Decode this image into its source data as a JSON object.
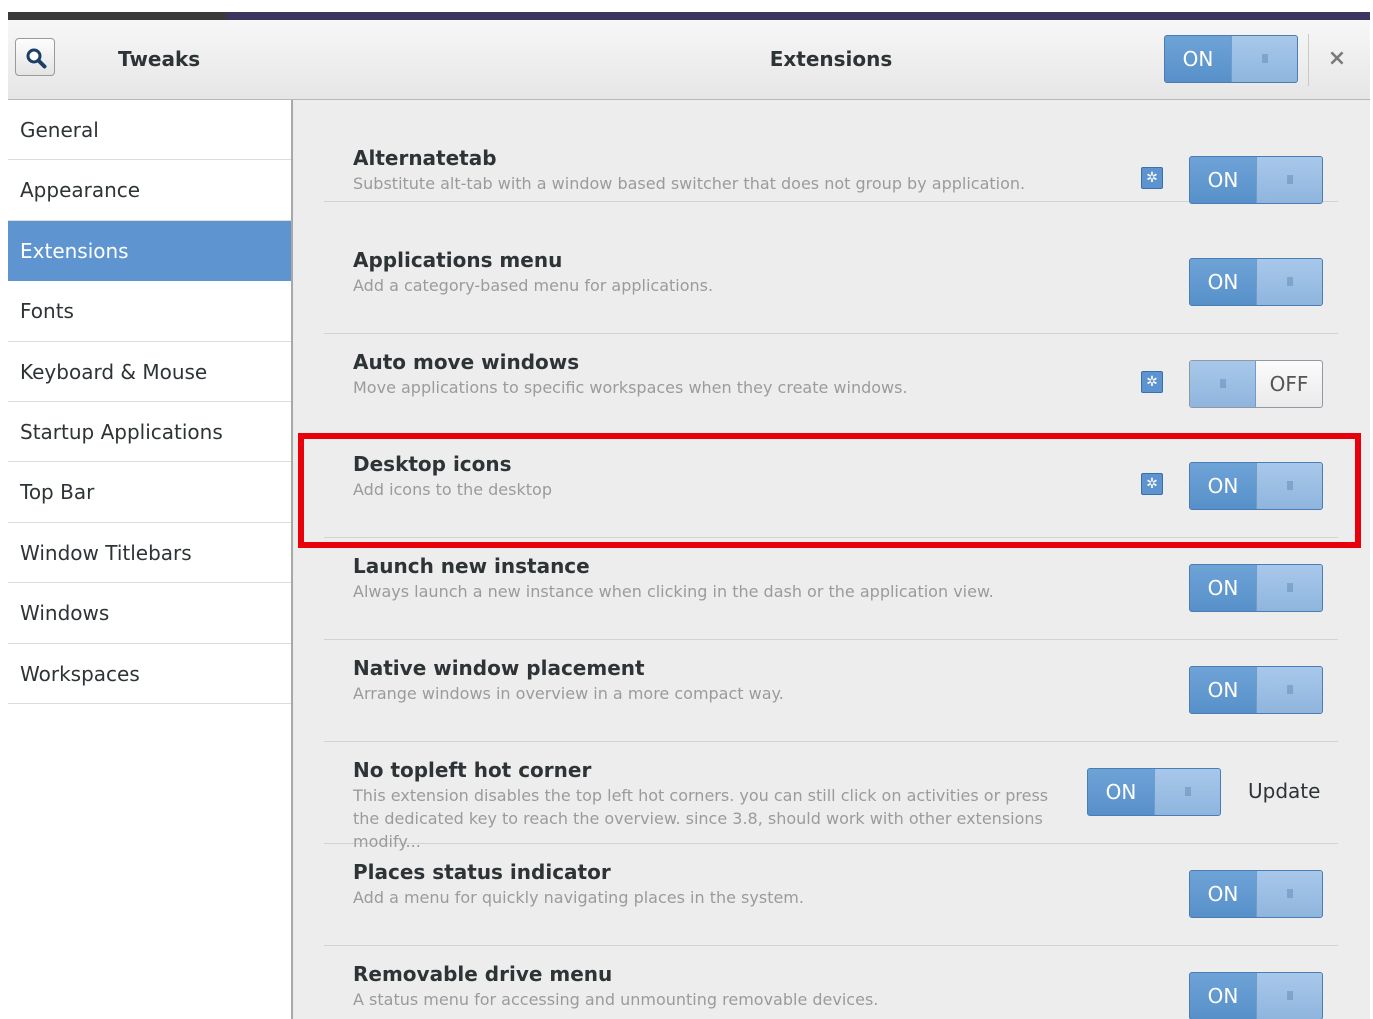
{
  "header": {
    "app_title": "Tweaks",
    "page_title": "Extensions",
    "master_switch": "ON",
    "close_label": "×"
  },
  "sidebar": {
    "items": [
      {
        "label": "General"
      },
      {
        "label": "Appearance"
      },
      {
        "label": "Extensions"
      },
      {
        "label": "Fonts"
      },
      {
        "label": "Keyboard & Mouse"
      },
      {
        "label": "Startup Applications"
      },
      {
        "label": "Top Bar"
      },
      {
        "label": "Window Titlebars"
      },
      {
        "label": "Windows"
      },
      {
        "label": "Workspaces"
      }
    ],
    "selected": "Extensions"
  },
  "extensions": [
    {
      "name": "Alternatetab",
      "description": "Substitute alt-tab with a window based switcher that does not group by application.",
      "state": "ON",
      "has_settings": true
    },
    {
      "name": "Applications menu",
      "description": "Add a category-based menu for applications.",
      "state": "ON",
      "has_settings": false
    },
    {
      "name": "Auto move windows",
      "description": "Move applications to specific workspaces when they create windows.",
      "state": "OFF",
      "has_settings": true
    },
    {
      "name": "Desktop icons",
      "description": "Add icons to the desktop",
      "state": "ON",
      "has_settings": true
    },
    {
      "name": "Launch new instance",
      "description": "Always launch a new instance when clicking in the dash or the application view.",
      "state": "ON",
      "has_settings": false
    },
    {
      "name": "Native window placement",
      "description": "Arrange windows in overview in a more compact way.",
      "state": "ON",
      "has_settings": false
    },
    {
      "name": "No topleft hot corner",
      "description": "This extension disables the top left hot corners. you can still click on activities or press the dedicated key to reach the overview. since 3.8, should work with other extensions modify...",
      "state": "ON",
      "has_settings": false,
      "action": "Update"
    },
    {
      "name": "Places status indicator",
      "description": "Add a menu for quickly navigating places in the system.",
      "state": "ON",
      "has_settings": false
    },
    {
      "name": "Removable drive menu",
      "description": "A status menu for accessing and unmounting removable devices.",
      "state": "ON",
      "has_settings": false
    }
  ],
  "colors": {
    "accent": "#5e95d1",
    "highlight_box": "#e8000b"
  },
  "icons": {
    "search": "search-icon",
    "settings": "gear-icon",
    "close": "close-icon"
  }
}
